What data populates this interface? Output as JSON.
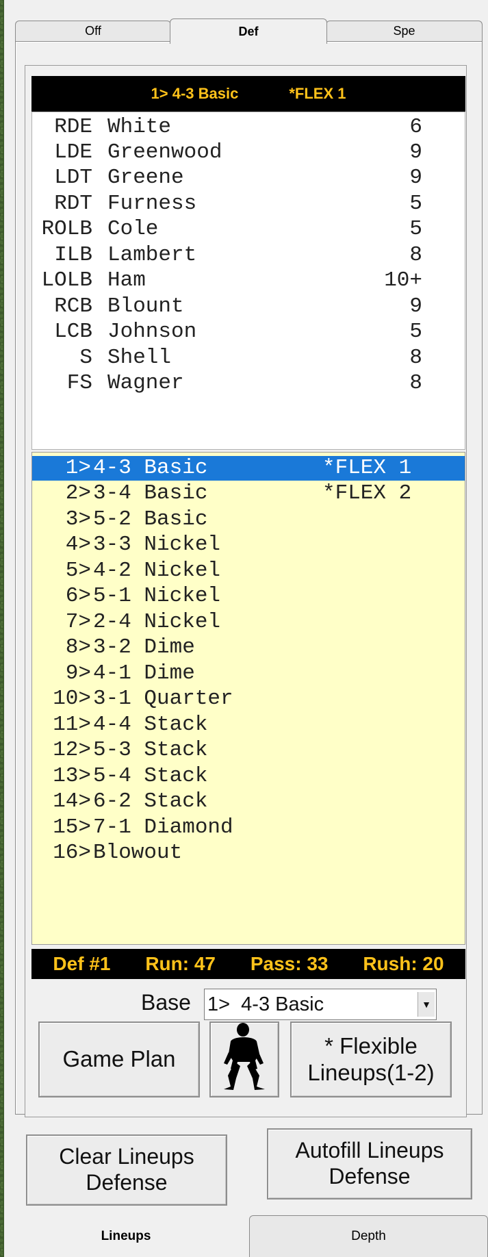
{
  "top_tabs": [
    {
      "label": "Off",
      "active": false
    },
    {
      "label": "Def",
      "active": true
    },
    {
      "label": "Spe",
      "active": false
    }
  ],
  "header": {
    "formation": "1> 4-3 Basic",
    "flex": "*FLEX 1"
  },
  "roster": [
    {
      "pos": "RDE",
      "name": "White",
      "value": "6"
    },
    {
      "pos": "LDE",
      "name": "Greenwood",
      "value": "9"
    },
    {
      "pos": "LDT",
      "name": "Greene",
      "value": "9"
    },
    {
      "pos": "RDT",
      "name": "Furness",
      "value": "5"
    },
    {
      "pos": "ROLB",
      "name": "Cole",
      "value": "5"
    },
    {
      "pos": "ILB",
      "name": "Lambert",
      "value": "8"
    },
    {
      "pos": "LOLB",
      "name": "Ham",
      "value": "10+"
    },
    {
      "pos": "RCB",
      "name": "Blount",
      "value": "9"
    },
    {
      "pos": "LCB",
      "name": "Johnson",
      "value": "5"
    },
    {
      "pos": "S",
      "name": "Shell",
      "value": "8"
    },
    {
      "pos": "FS",
      "name": "Wagner",
      "value": "8"
    }
  ],
  "formations": [
    {
      "num": "1>",
      "name": "4-3 Basic",
      "flex": "*FLEX 1",
      "selected": true
    },
    {
      "num": "2>",
      "name": "3-4 Basic",
      "flex": "*FLEX 2",
      "selected": false
    },
    {
      "num": "3>",
      "name": "5-2 Basic",
      "flex": "",
      "selected": false
    },
    {
      "num": "4>",
      "name": "3-3 Nickel",
      "flex": "",
      "selected": false
    },
    {
      "num": "5>",
      "name": "4-2 Nickel",
      "flex": "",
      "selected": false
    },
    {
      "num": "6>",
      "name": "5-1 Nickel",
      "flex": "",
      "selected": false
    },
    {
      "num": "7>",
      "name": "2-4 Nickel",
      "flex": "",
      "selected": false
    },
    {
      "num": "8>",
      "name": "3-2 Dime",
      "flex": "",
      "selected": false
    },
    {
      "num": "9>",
      "name": "4-1 Dime",
      "flex": "",
      "selected": false
    },
    {
      "num": "10>",
      "name": "3-1 Quarter",
      "flex": "",
      "selected": false
    },
    {
      "num": "11>",
      "name": "4-4 Stack",
      "flex": "",
      "selected": false
    },
    {
      "num": "12>",
      "name": "5-3 Stack",
      "flex": "",
      "selected": false
    },
    {
      "num": "13>",
      "name": "5-4 Stack",
      "flex": "",
      "selected": false
    },
    {
      "num": "14>",
      "name": "6-2 Stack",
      "flex": "",
      "selected": false
    },
    {
      "num": "15>",
      "name": "7-1 Diamond",
      "flex": "",
      "selected": false
    },
    {
      "num": "16>",
      "name": "Blowout",
      "flex": "",
      "selected": false
    }
  ],
  "stats": {
    "def": "Def #1",
    "run": "Run: 47",
    "pass": "Pass: 33",
    "rush": "Rush: 20"
  },
  "base": {
    "label": "Base",
    "value": "1>  4-3 Basic"
  },
  "buttons": {
    "game_plan": "Game Plan",
    "flexible": "* Flexible Lineups(1-2)",
    "clear": "Clear Lineups Defense",
    "autofill": "Autofill Lineups Defense"
  },
  "bottom_tabs": [
    {
      "label": "Lineups",
      "active": true
    },
    {
      "label": "Depth",
      "active": false
    }
  ],
  "icons": {
    "player": "defensive-player-silhouette-icon"
  },
  "colors": {
    "header_bg": "#000000",
    "header_text": "#ffc21a",
    "selection": "#1a79d8",
    "list_bg": "#ffffc8"
  }
}
